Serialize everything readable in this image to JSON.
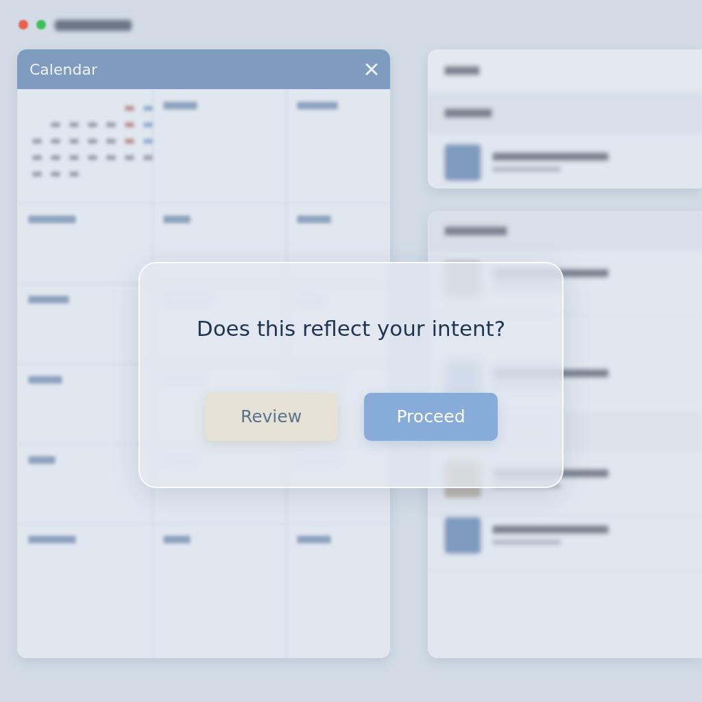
{
  "window": {
    "traffic_lights": [
      {
        "color": "#e8604c"
      },
      {
        "color": "#3cc05a"
      }
    ]
  },
  "calendar": {
    "title": "Calendar"
  },
  "dialog": {
    "question": "Does this reflect your intent?",
    "buttons": [
      {
        "label": "Review",
        "kind": "secondary"
      },
      {
        "label": "Proceed",
        "kind": "primary"
      }
    ]
  }
}
